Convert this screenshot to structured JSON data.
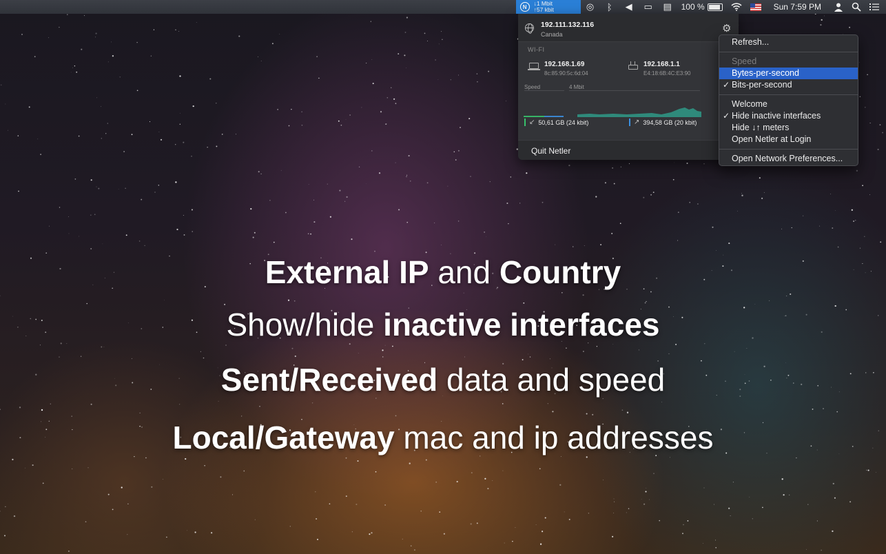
{
  "menubar": {
    "netler_down": "↓1 Mbit",
    "netler_up": "↑57 kbit",
    "netler_logo": "N",
    "battery_percent": "100 %",
    "clock": "Sun 7:59 PM",
    "icons": [
      "netler-icon",
      "target-icon",
      "bluetooth-icon",
      "volume-icon",
      "airplay-icon",
      "keyboard-icon",
      "battery-icon",
      "wifi-icon",
      "us-flag-icon",
      "user-icon",
      "search-icon",
      "list-icon"
    ]
  },
  "panel": {
    "external_ip": "192.111.132.116",
    "country": "Canada",
    "interface_label": "WI-FI",
    "local": {
      "ip": "192.168.1.69",
      "mac": "8c:85:90:5c:6d:04"
    },
    "gateway": {
      "ip": "192.168.1.1",
      "mac": "E4:18:6B:4C:E3:90"
    },
    "speed_label": "Speed",
    "max_speed_label": "4 Mbit",
    "received_total": "50,61 GB (24 kbit)",
    "sent_total": "394,58 GB (20 kbit)",
    "quit_label": "Quit Netler",
    "colors": {
      "download": "#37c26b",
      "upload": "#3b8fe0"
    }
  },
  "menu": {
    "refresh": "Refresh...",
    "speed_header": "Speed",
    "bytes_per_second": "Bytes-per-second",
    "bits_per_second": "Bits-per-second",
    "welcome": "Welcome",
    "hide_inactive": "Hide inactive interfaces",
    "hide_meters": "Hide ↓↑ meters",
    "open_at_login": "Open Netler at Login",
    "open_network_prefs": "Open Network Preferences...",
    "check_mark": "✓"
  },
  "headlines": {
    "line1_a": "External IP",
    "line1_b": " and ",
    "line1_c": "Country",
    "line2_a": "Show/hide ",
    "line2_b": "inactive interfaces",
    "line3_a": "Sent/Received",
    "line3_b": " data and speed",
    "line4_a": "Local/Gateway",
    "line4_b": " mac and ip addresses"
  }
}
